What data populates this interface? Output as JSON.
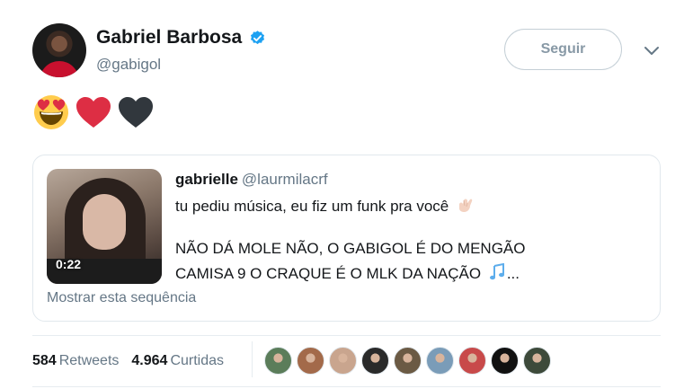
{
  "author": {
    "name": "Gabriel Barbosa",
    "handle": "@gabigol",
    "verified": true,
    "verified_color": "#1da1f2"
  },
  "follow_button": {
    "label": "Seguir"
  },
  "menu": {
    "icon": "chevron-down-icon"
  },
  "tweet_emojis": [
    "heart-eyes-emoji",
    "red-heart-emoji",
    "black-heart-emoji"
  ],
  "quoted": {
    "name": "gabrielle",
    "handle": "@laurmilacrf",
    "line1": "tu pediu música, eu fiz um funk pra você",
    "line1_emoji": "call-me-hand-emoji",
    "line2": "NÃO DÁ MOLE NÃO, O GABIGOL É DO MENGÃO",
    "line3": "CAMISA 9 O CRAQUE É O MLK DA NAÇÃO",
    "line3_emoji": "musical-notes-emoji",
    "line3_suffix": "...",
    "video_duration": "0:22",
    "show_thread": "Mostrar esta sequência"
  },
  "stats": {
    "retweets_count": "584",
    "retweets_label": "Retweets",
    "likes_count": "4.964",
    "likes_label": "Curtidas"
  },
  "likers": [
    {
      "color": "#5b7d5a"
    },
    {
      "color": "#a36a4a"
    },
    {
      "color": "#c9a58e"
    },
    {
      "color": "#2a2a2a"
    },
    {
      "color": "#6b5a44"
    },
    {
      "color": "#7a9cb8"
    },
    {
      "color": "#c84a4a"
    },
    {
      "color": "#111111"
    },
    {
      "color": "#3d4a3a"
    }
  ]
}
